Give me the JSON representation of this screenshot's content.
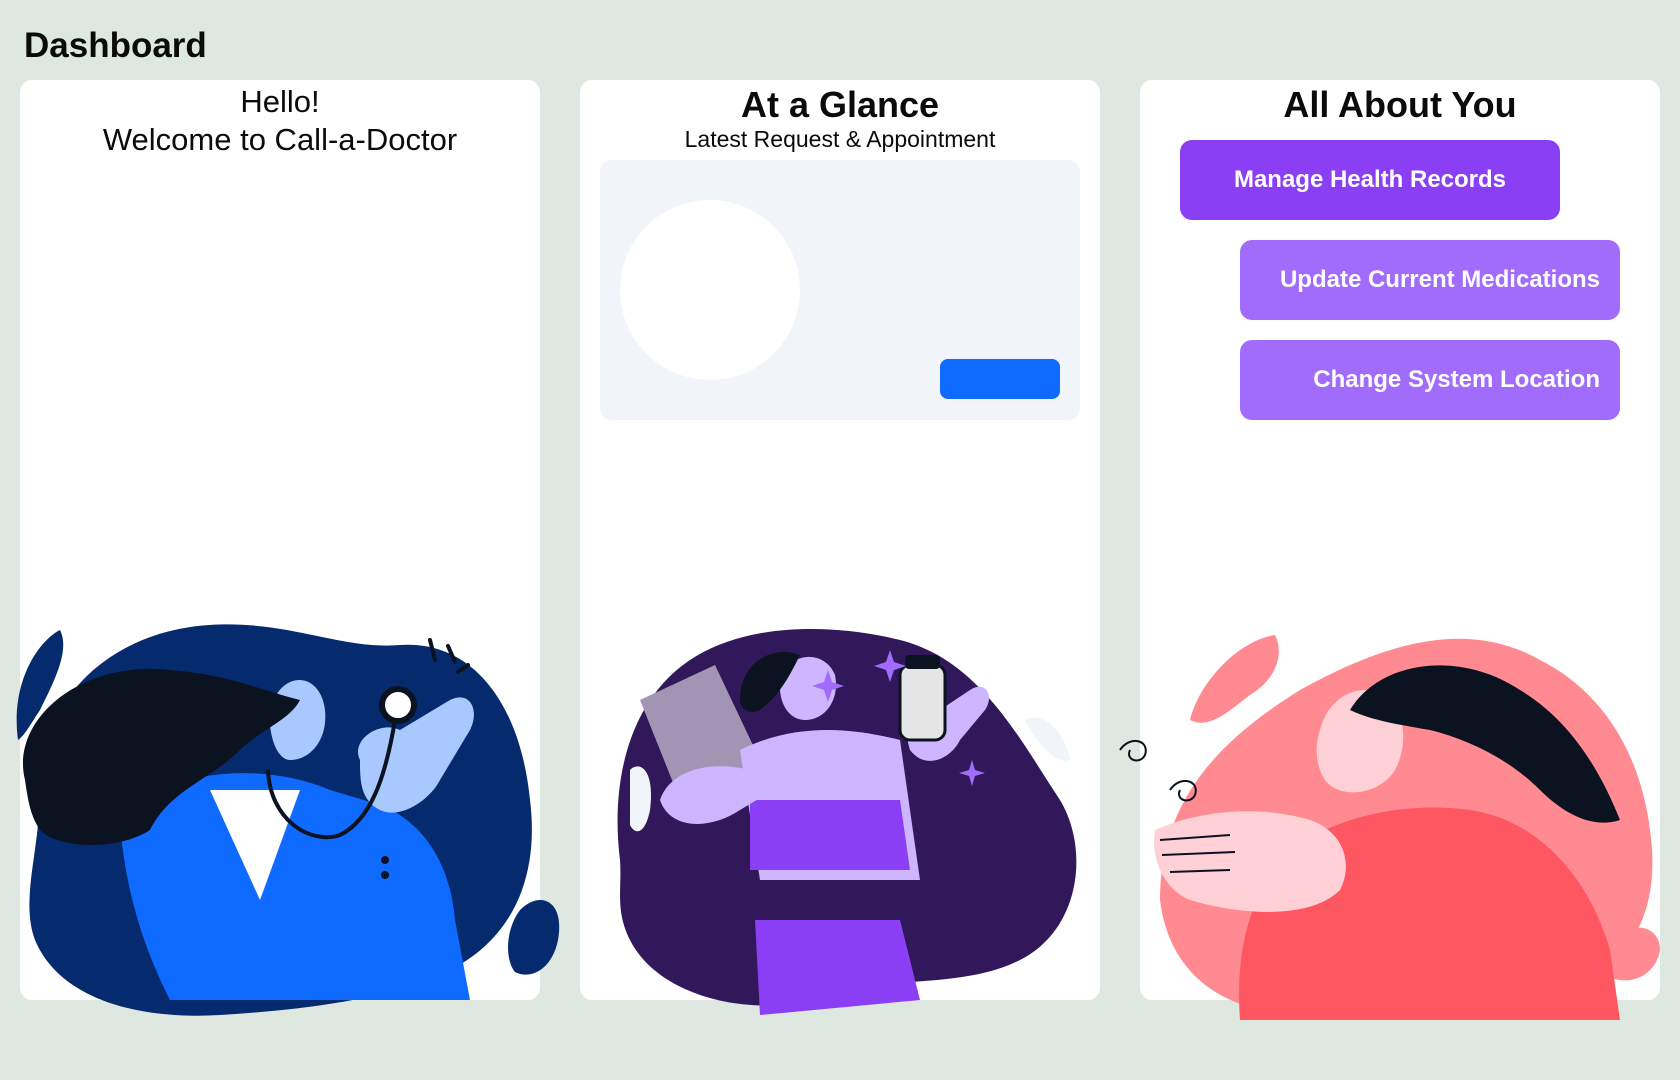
{
  "page": {
    "title": "Dashboard"
  },
  "welcome_card": {
    "greeting": "Hello!",
    "welcome_text": "Welcome to Call-a-Doctor"
  },
  "glance_card": {
    "heading": "At a Glance",
    "subheading": "Latest Request & Appointment"
  },
  "about_card": {
    "heading": "All About You",
    "buttons": [
      {
        "label": "Manage Health Records"
      },
      {
        "label": "Update Current Medications"
      },
      {
        "label": "Change System Location"
      }
    ]
  },
  "colors": {
    "background": "#dfe7e1",
    "card": "#ffffff",
    "primary_button": "#8b3ff5",
    "secondary_button": "#a16bfb",
    "glance_panel": "#f1f5f9",
    "glance_action": "#0f6bff",
    "doctor_blob": "#052a6e",
    "fitness_blob": "#31185a",
    "relax_blob": "#ff8a92"
  },
  "illustrations": [
    {
      "icon": "doctor-stethoscope-illustration"
    },
    {
      "icon": "fitness-supplement-illustration"
    },
    {
      "icon": "relaxing-woman-illustration"
    }
  ]
}
